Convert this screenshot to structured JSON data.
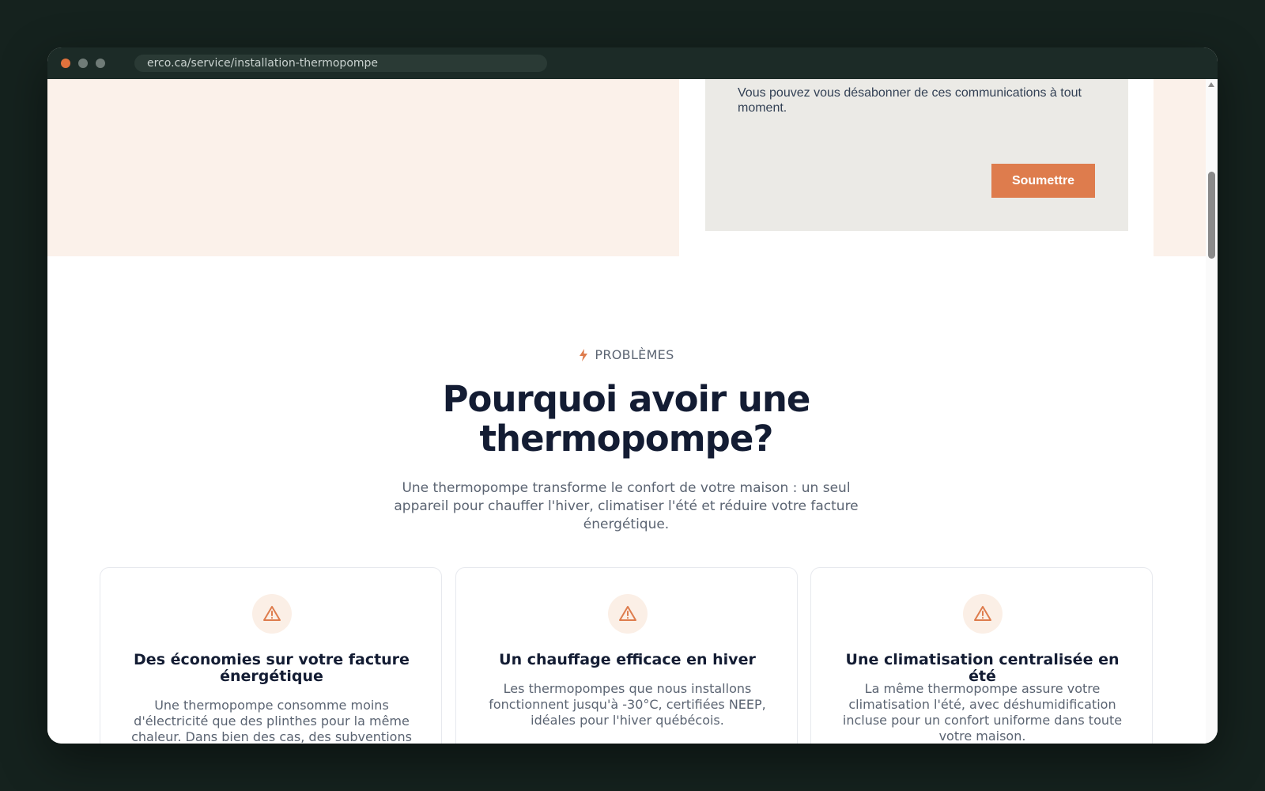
{
  "browser": {
    "url": "erco.ca/service/installation-thermopompe"
  },
  "form": {
    "unsubscribe_note": "Vous pouvez vous désabonner de ces communications à tout moment.",
    "submit_label": "Soumettre"
  },
  "section": {
    "eyebrow": "PROBLÈMES",
    "eyebrow_icon": "bolt-icon",
    "title": "Pourquoi avoir une thermopompe?",
    "subtitle": "Une thermopompe transforme le confort de votre maison : un seul appareil pour chauffer l'hiver, climatiser l'été et réduire votre facture énergétique."
  },
  "cards": [
    {
      "icon": "warning-triangle-icon",
      "title": "Des économies sur votre facture énergétique",
      "text": "Une thermopompe consomme moins d'électricité que des plinthes pour la même chaleur. Dans bien des cas, des subventions"
    },
    {
      "icon": "warning-triangle-icon",
      "title": "Un chauffage efficace en hiver",
      "text": "Les thermopompes que nous installons fonctionnent jusqu'à -30°C, certifiées NEEP, idéales pour l'hiver québécois."
    },
    {
      "icon": "warning-triangle-icon",
      "title": "Une climatisation centralisée en été",
      "text": "La même thermopompe assure votre climatisation l'été, avec déshumidification incluse pour un confort uniforme dans toute votre maison."
    }
  ],
  "colors": {
    "accent": "#de7c4d",
    "heading": "#131c33",
    "muted_text": "#5b6472",
    "hero_band": "#fbf1ea",
    "form_panel": "#ebeae6",
    "frame": "#15221e"
  }
}
